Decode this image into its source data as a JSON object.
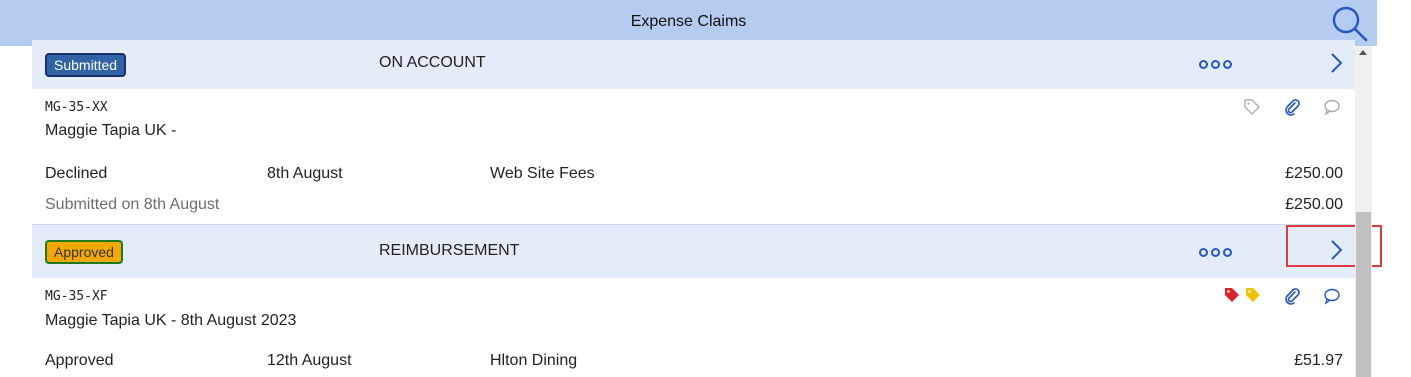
{
  "header": {
    "title": "Expense Claims",
    "search_icon": "search-icon",
    "background": "#b3ccef"
  },
  "claims": [
    {
      "status_badge": "Submitted",
      "claim_type": "ON ACCOUNT",
      "reference": "MG-35-XX",
      "claimant": "Maggie Tapia UK -",
      "line": {
        "status": "Declined",
        "date": "8th August",
        "description": "Web Site Fees",
        "amount": "£250.00"
      },
      "submitted_text": "Submitted on 8th August",
      "total": "£250.00",
      "icons": [
        "tag-outline-icon",
        "paperclip-icon",
        "comment-icon"
      ]
    },
    {
      "status_badge": "Approved",
      "claim_type": "REIMBURSEMENT",
      "reference": "MG-35-XF",
      "claimant": "Maggie Tapia UK - 8th August 2023",
      "line": {
        "status": "Approved",
        "date": "12th August",
        "description": "Hlton Dining",
        "amount": "£51.97"
      },
      "icons": [
        "tag-red-icon",
        "tag-yellow-icon",
        "paperclip-icon",
        "comment-icon"
      ]
    }
  ],
  "colors": {
    "accent": "#2457c5",
    "submitted_badge": "#2f63a6",
    "approved_badge": "#f2a800",
    "row_band": "#e4ecf9",
    "highlight": "#e0393e"
  }
}
